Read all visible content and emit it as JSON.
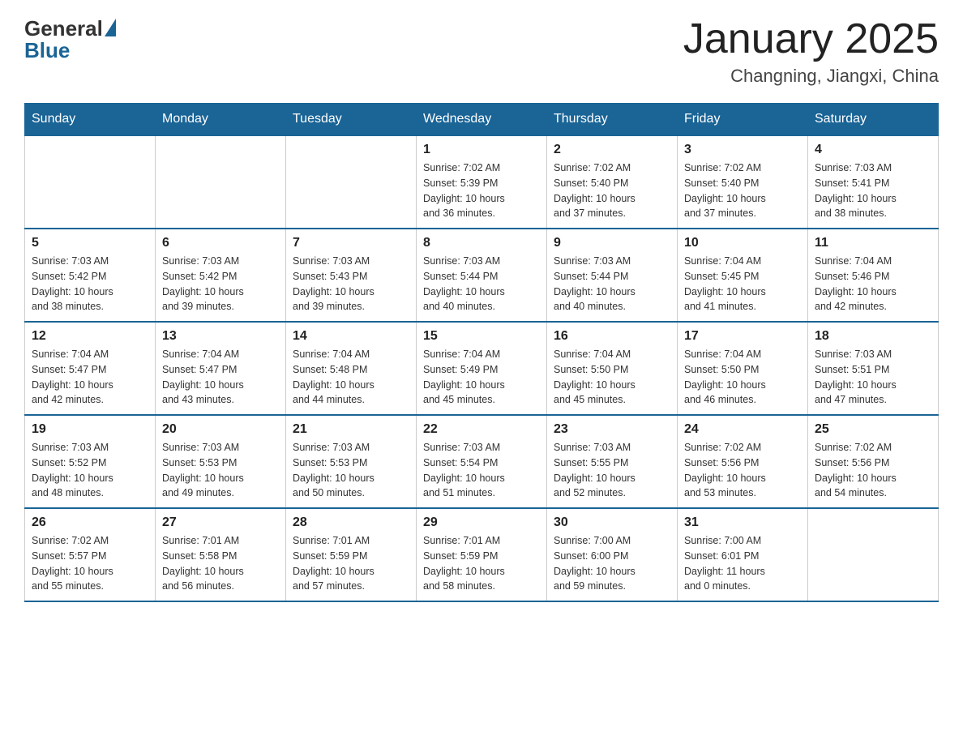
{
  "header": {
    "logo": {
      "text_general": "General",
      "text_blue": "Blue"
    },
    "title": "January 2025",
    "location": "Changning, Jiangxi, China"
  },
  "calendar": {
    "days_of_week": [
      "Sunday",
      "Monday",
      "Tuesday",
      "Wednesday",
      "Thursday",
      "Friday",
      "Saturday"
    ],
    "weeks": [
      [
        {
          "day": "",
          "info": ""
        },
        {
          "day": "",
          "info": ""
        },
        {
          "day": "",
          "info": ""
        },
        {
          "day": "1",
          "info": "Sunrise: 7:02 AM\nSunset: 5:39 PM\nDaylight: 10 hours\nand 36 minutes."
        },
        {
          "day": "2",
          "info": "Sunrise: 7:02 AM\nSunset: 5:40 PM\nDaylight: 10 hours\nand 37 minutes."
        },
        {
          "day": "3",
          "info": "Sunrise: 7:02 AM\nSunset: 5:40 PM\nDaylight: 10 hours\nand 37 minutes."
        },
        {
          "day": "4",
          "info": "Sunrise: 7:03 AM\nSunset: 5:41 PM\nDaylight: 10 hours\nand 38 minutes."
        }
      ],
      [
        {
          "day": "5",
          "info": "Sunrise: 7:03 AM\nSunset: 5:42 PM\nDaylight: 10 hours\nand 38 minutes."
        },
        {
          "day": "6",
          "info": "Sunrise: 7:03 AM\nSunset: 5:42 PM\nDaylight: 10 hours\nand 39 minutes."
        },
        {
          "day": "7",
          "info": "Sunrise: 7:03 AM\nSunset: 5:43 PM\nDaylight: 10 hours\nand 39 minutes."
        },
        {
          "day": "8",
          "info": "Sunrise: 7:03 AM\nSunset: 5:44 PM\nDaylight: 10 hours\nand 40 minutes."
        },
        {
          "day": "9",
          "info": "Sunrise: 7:03 AM\nSunset: 5:44 PM\nDaylight: 10 hours\nand 40 minutes."
        },
        {
          "day": "10",
          "info": "Sunrise: 7:04 AM\nSunset: 5:45 PM\nDaylight: 10 hours\nand 41 minutes."
        },
        {
          "day": "11",
          "info": "Sunrise: 7:04 AM\nSunset: 5:46 PM\nDaylight: 10 hours\nand 42 minutes."
        }
      ],
      [
        {
          "day": "12",
          "info": "Sunrise: 7:04 AM\nSunset: 5:47 PM\nDaylight: 10 hours\nand 42 minutes."
        },
        {
          "day": "13",
          "info": "Sunrise: 7:04 AM\nSunset: 5:47 PM\nDaylight: 10 hours\nand 43 minutes."
        },
        {
          "day": "14",
          "info": "Sunrise: 7:04 AM\nSunset: 5:48 PM\nDaylight: 10 hours\nand 44 minutes."
        },
        {
          "day": "15",
          "info": "Sunrise: 7:04 AM\nSunset: 5:49 PM\nDaylight: 10 hours\nand 45 minutes."
        },
        {
          "day": "16",
          "info": "Sunrise: 7:04 AM\nSunset: 5:50 PM\nDaylight: 10 hours\nand 45 minutes."
        },
        {
          "day": "17",
          "info": "Sunrise: 7:04 AM\nSunset: 5:50 PM\nDaylight: 10 hours\nand 46 minutes."
        },
        {
          "day": "18",
          "info": "Sunrise: 7:03 AM\nSunset: 5:51 PM\nDaylight: 10 hours\nand 47 minutes."
        }
      ],
      [
        {
          "day": "19",
          "info": "Sunrise: 7:03 AM\nSunset: 5:52 PM\nDaylight: 10 hours\nand 48 minutes."
        },
        {
          "day": "20",
          "info": "Sunrise: 7:03 AM\nSunset: 5:53 PM\nDaylight: 10 hours\nand 49 minutes."
        },
        {
          "day": "21",
          "info": "Sunrise: 7:03 AM\nSunset: 5:53 PM\nDaylight: 10 hours\nand 50 minutes."
        },
        {
          "day": "22",
          "info": "Sunrise: 7:03 AM\nSunset: 5:54 PM\nDaylight: 10 hours\nand 51 minutes."
        },
        {
          "day": "23",
          "info": "Sunrise: 7:03 AM\nSunset: 5:55 PM\nDaylight: 10 hours\nand 52 minutes."
        },
        {
          "day": "24",
          "info": "Sunrise: 7:02 AM\nSunset: 5:56 PM\nDaylight: 10 hours\nand 53 minutes."
        },
        {
          "day": "25",
          "info": "Sunrise: 7:02 AM\nSunset: 5:56 PM\nDaylight: 10 hours\nand 54 minutes."
        }
      ],
      [
        {
          "day": "26",
          "info": "Sunrise: 7:02 AM\nSunset: 5:57 PM\nDaylight: 10 hours\nand 55 minutes."
        },
        {
          "day": "27",
          "info": "Sunrise: 7:01 AM\nSunset: 5:58 PM\nDaylight: 10 hours\nand 56 minutes."
        },
        {
          "day": "28",
          "info": "Sunrise: 7:01 AM\nSunset: 5:59 PM\nDaylight: 10 hours\nand 57 minutes."
        },
        {
          "day": "29",
          "info": "Sunrise: 7:01 AM\nSunset: 5:59 PM\nDaylight: 10 hours\nand 58 minutes."
        },
        {
          "day": "30",
          "info": "Sunrise: 7:00 AM\nSunset: 6:00 PM\nDaylight: 10 hours\nand 59 minutes."
        },
        {
          "day": "31",
          "info": "Sunrise: 7:00 AM\nSunset: 6:01 PM\nDaylight: 11 hours\nand 0 minutes."
        },
        {
          "day": "",
          "info": ""
        }
      ]
    ]
  }
}
